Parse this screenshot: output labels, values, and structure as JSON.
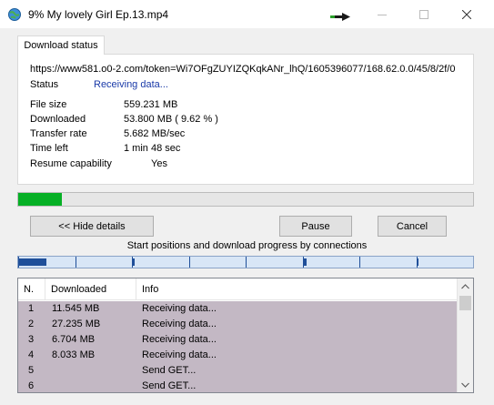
{
  "window": {
    "title": "9% My lovely Girl Ep.13.mp4",
    "accent_color": "#06b025"
  },
  "tabs": [
    {
      "label": "Download status",
      "selected": true
    }
  ],
  "status": {
    "url": "https://www581.o0-2.com/token=Wi7OFgZUYIZQKqkANr_lhQ/1605396077/168.62.0.0/45/8/2f/0",
    "status_label": "Status",
    "status_value": "Receiving data...",
    "file_size_label": "File size",
    "file_size_value": "559.231  MB",
    "downloaded_label": "Downloaded",
    "downloaded_value": "53.800  MB  ( 9.62 % )",
    "transfer_rate_label": "Transfer rate",
    "transfer_rate_value": "5.682  MB/sec",
    "time_left_label": "Time left",
    "time_left_value": "1 min 48 sec",
    "resume_label": "Resume capability",
    "resume_value": "Yes"
  },
  "progress": {
    "fraction": 0.0962
  },
  "buttons": {
    "hide_details": "<< Hide details",
    "pause": "Pause",
    "cancel": "Cancel"
  },
  "connections": {
    "caption": "Start positions and download progress by connections",
    "segments": [
      {
        "start": 0.0,
        "done": 0.062
      },
      {
        "start": 0.125,
        "done": 0.0
      },
      {
        "start": 0.25,
        "done": 0.005
      },
      {
        "start": 0.375,
        "done": 0.0
      },
      {
        "start": 0.5,
        "done": 0.0
      },
      {
        "start": 0.625,
        "done": 0.008
      },
      {
        "start": 0.75,
        "done": 0.0
      },
      {
        "start": 0.875,
        "done": 0.004
      }
    ]
  },
  "table": {
    "columns": [
      "N.",
      "Downloaded",
      "Info"
    ],
    "rows": [
      {
        "n": "1",
        "downloaded": "11.545  MB",
        "info": "Receiving data..."
      },
      {
        "n": "2",
        "downloaded": "27.235  MB",
        "info": "Receiving data..."
      },
      {
        "n": "3",
        "downloaded": "6.704  MB",
        "info": "Receiving data..."
      },
      {
        "n": "4",
        "downloaded": "8.033  MB",
        "info": "Receiving data..."
      },
      {
        "n": "5",
        "downloaded": "",
        "info": "Send GET..."
      },
      {
        "n": "6",
        "downloaded": "",
        "info": "Send GET..."
      }
    ]
  },
  "icons": [
    "app-globe-icon",
    "download-arrow-icon",
    "minimize-icon",
    "maximize-icon",
    "close-icon",
    "scroll-up-icon",
    "scroll-down-icon"
  ]
}
